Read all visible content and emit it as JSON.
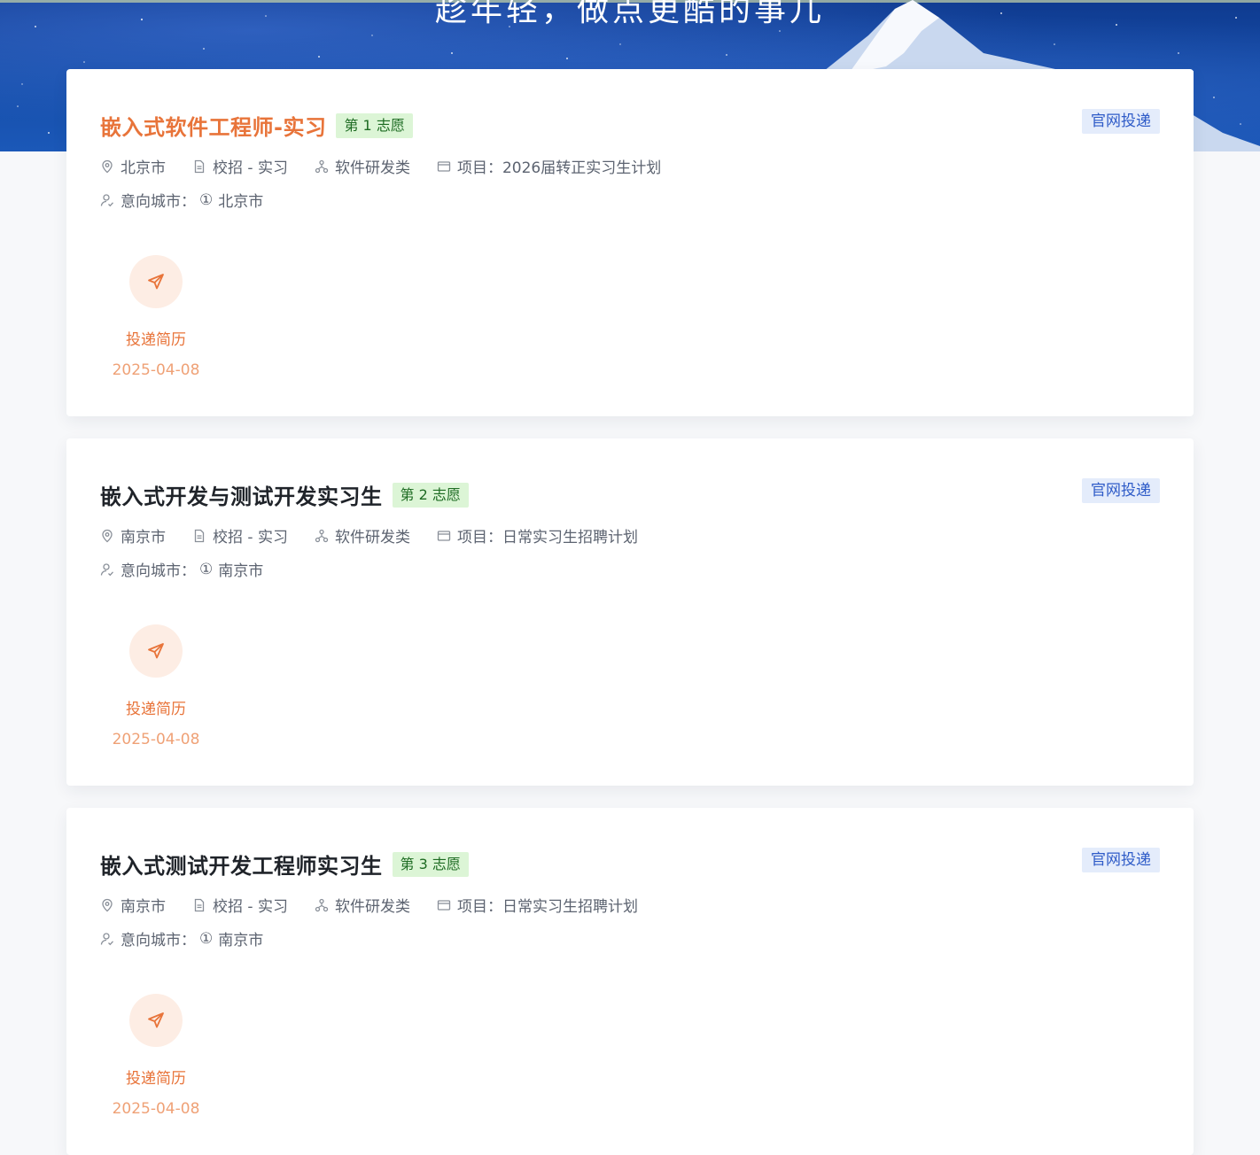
{
  "banner": {
    "slogan": "趁年轻，做点更酷的事儿"
  },
  "applications": [
    {
      "title": "嵌入式软件工程师-实习",
      "preference": "第 1 志愿",
      "channel": "官网投递",
      "location": "北京市",
      "recruit_type": "校招 - 实习",
      "category": "软件研发类",
      "project": "项目：2026届转正实习生计划",
      "intent_label": "意向城市：",
      "intent_no": "①",
      "intent_city": "北京市",
      "step_label": "投递简历",
      "step_date": "2025-04-08"
    },
    {
      "title": "嵌入式开发与测试开发实习生",
      "preference": "第 2 志愿",
      "channel": "官网投递",
      "location": "南京市",
      "recruit_type": "校招 - 实习",
      "category": "软件研发类",
      "project": "项目：日常实习生招聘计划",
      "intent_label": "意向城市：",
      "intent_no": "①",
      "intent_city": "南京市",
      "step_label": "投递简历",
      "step_date": "2025-04-08"
    },
    {
      "title": "嵌入式测试开发工程师实习生",
      "preference": "第 3 志愿",
      "channel": "官网投递",
      "location": "南京市",
      "recruit_type": "校招 - 实习",
      "category": "软件研发类",
      "project": "项目：日常实习生招聘计划",
      "intent_label": "意向城市：",
      "intent_no": "①",
      "intent_city": "南京市",
      "step_label": "投递简历",
      "step_date": "2025-04-08"
    }
  ],
  "icons": {
    "location": "location-pin-icon",
    "recruit_type": "document-icon",
    "category": "org-chart-icon",
    "project": "window-icon",
    "intent": "user-check-icon",
    "step": "paper-plane-icon"
  },
  "colors": {
    "accent": "#e8743a",
    "badge_green_bg": "#dcf5d6",
    "badge_blue_bg": "#e4ecfb",
    "banner": "#154da8"
  }
}
